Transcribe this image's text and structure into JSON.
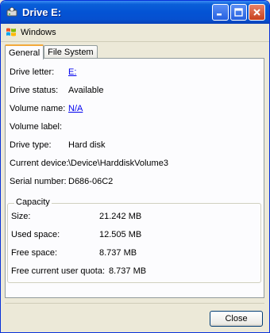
{
  "window": {
    "title": "Drive E:"
  },
  "toolbar": {
    "windows_label": "Windows"
  },
  "tabs": [
    {
      "label": "General",
      "active": true
    },
    {
      "label": "File System",
      "active": false
    }
  ],
  "general": {
    "drive_letter_label": "Drive letter:",
    "drive_letter_value": "E:",
    "drive_status_label": "Drive status:",
    "drive_status_value": "Available",
    "volume_name_label": "Volume name:",
    "volume_name_value": "N/A",
    "volume_label_label": "Volume label:",
    "volume_label_value": "",
    "drive_type_label": "Drive type:",
    "drive_type_value": "Hard disk",
    "current_device_label": "Current device:",
    "current_device_value": "\\Device\\HarddiskVolume3",
    "serial_number_label": "Serial number:",
    "serial_number_value": "D686-06C2"
  },
  "capacity": {
    "title": "Capacity",
    "size_label": "Size:",
    "size_value": "21.242 MB",
    "used_label": "Used space:",
    "used_value": "12.505 MB",
    "free_label": "Free space:",
    "free_value": "8.737 MB",
    "quota_label": "Free current user quota:",
    "quota_value": "8.737 MB"
  },
  "footer": {
    "close_label": "Close"
  },
  "colors": {
    "titlebar": "#0453d4",
    "link": "#0000ee",
    "tab_highlight": "#f2a93a"
  },
  "icons": [
    "drive-icon",
    "minimize-icon",
    "maximize-icon",
    "close-icon",
    "windows-logo-icon"
  ]
}
